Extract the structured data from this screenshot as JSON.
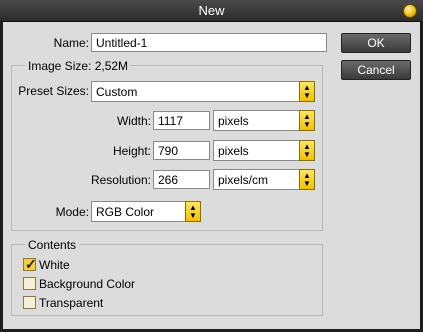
{
  "window": {
    "title": "New"
  },
  "name": {
    "label": "Name:",
    "value": "Untitled-1"
  },
  "image_size": {
    "label": "Image Size: 2,52M"
  },
  "preset": {
    "label": "Preset Sizes:",
    "value": "Custom"
  },
  "width": {
    "label": "Width:",
    "value": "1117",
    "unit": "pixels"
  },
  "height": {
    "label": "Height:",
    "value": "790",
    "unit": "pixels"
  },
  "resolution": {
    "label": "Resolution:",
    "value": "266",
    "unit": "pixels/cm"
  },
  "mode": {
    "label": "Mode:",
    "value": "RGB Color"
  },
  "contents": {
    "label": "Contents",
    "options": [
      {
        "label": "White",
        "checked": true
      },
      {
        "label": "Background Color",
        "checked": false
      },
      {
        "label": "Transparent",
        "checked": false
      }
    ]
  },
  "buttons": {
    "ok": "OK",
    "cancel": "Cancel"
  },
  "colors": {
    "accent": "#f2c200",
    "dialog_bg": "#dcdcdc",
    "title_bg": "#2b2b2b"
  }
}
